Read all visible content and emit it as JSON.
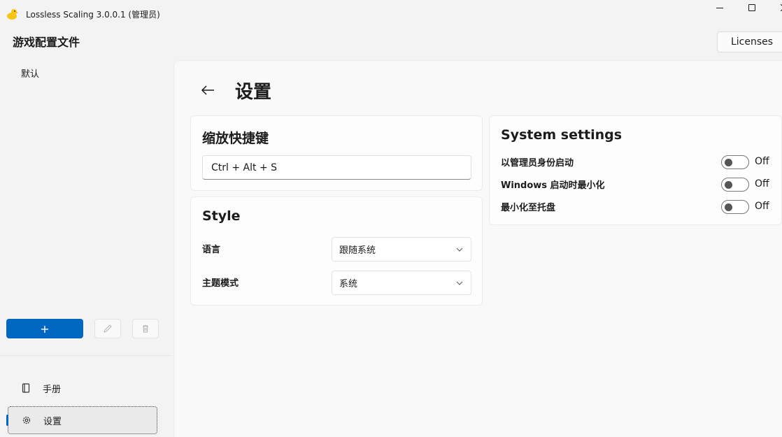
{
  "window": {
    "title": "Lossless Scaling 3.0.0.1 (管理员)"
  },
  "sidebar": {
    "title": "游戏配置文件",
    "profiles": [
      "默认"
    ],
    "add_label": "+",
    "nav": [
      {
        "label": "手册",
        "icon": "book-icon"
      },
      {
        "label": "设置",
        "icon": "gear-icon",
        "selected": true
      }
    ]
  },
  "header": {
    "licenses_label": "Licenses"
  },
  "page": {
    "title": "设置"
  },
  "hotkey_card": {
    "title": "缩放快捷键",
    "value": "Ctrl + Alt + S"
  },
  "style_card": {
    "title": "Style",
    "language_label": "语言",
    "language_value": "跟随系统",
    "theme_label": "主题模式",
    "theme_value": "系统"
  },
  "system_card": {
    "title": "System settings",
    "toggles": [
      {
        "label": "以管理员身份启动",
        "state": "Off"
      },
      {
        "label": "Windows 启动时最小化",
        "state": "Off"
      },
      {
        "label": "最小化至托盘",
        "state": "Off"
      }
    ]
  },
  "colors": {
    "accent": "#0067c0",
    "background": "#f3f3f3",
    "content": "#f9f9f9"
  }
}
